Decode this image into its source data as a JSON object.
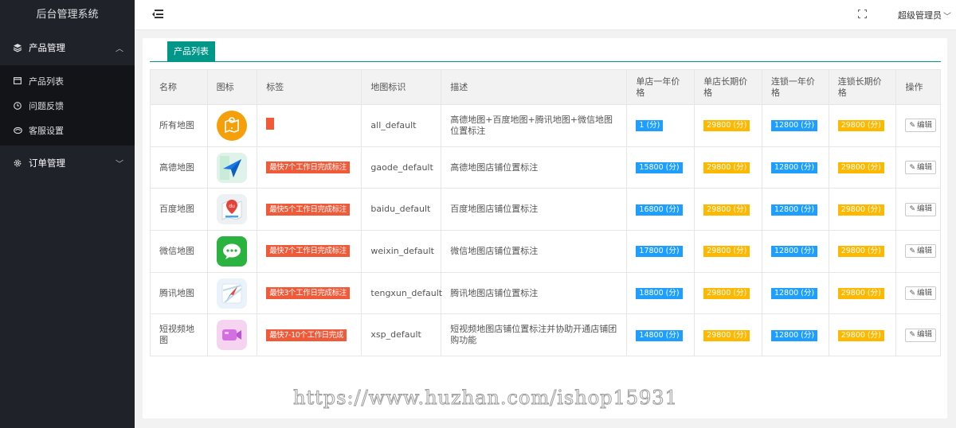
{
  "app": {
    "title": "后台管理系统"
  },
  "sidebar": {
    "groups": [
      {
        "label": "产品管理",
        "icon": "layers-icon",
        "expanded": true,
        "items": [
          {
            "label": "产品列表",
            "icon": "window-icon"
          },
          {
            "label": "问题反馈",
            "icon": "clock-icon"
          },
          {
            "label": "客服设置",
            "icon": "link-icon"
          }
        ]
      },
      {
        "label": "订单管理",
        "icon": "gear-icon",
        "expanded": false,
        "items": []
      }
    ]
  },
  "header": {
    "user_name": "超级管理员"
  },
  "tabs": [
    {
      "label": "产品列表",
      "active": true
    }
  ],
  "table": {
    "columns": [
      "名称",
      "图标",
      "标签",
      "地图标识",
      "描述",
      "单店一年价格",
      "单店长期价格",
      "连锁一年价格",
      "连锁长期价格",
      "操作"
    ],
    "rows": [
      {
        "name": "所有地图",
        "icon": "all-maps-icon",
        "tag": "",
        "key": "all_default",
        "desc": "高德地图+百度地图+腾讯地图+微信地图位置标注",
        "p1": "1 (分)",
        "p2": "29800 (分)",
        "p3": "12800 (分)",
        "p4": "29800 (分)",
        "action": "编辑"
      },
      {
        "name": "高德地图",
        "icon": "gaode-map-icon",
        "tag": "最快7个工作日完成标注",
        "key": "gaode_default",
        "desc": "高德地图店铺位置标注",
        "p1": "15800 (分)",
        "p2": "29800 (分)",
        "p3": "12800 (分)",
        "p4": "29800 (分)",
        "action": "编辑"
      },
      {
        "name": "百度地图",
        "icon": "baidu-map-icon",
        "tag": "最快5个工作日完成标注",
        "key": "baidu_default",
        "desc": "百度地图店铺位置标注",
        "p1": "16800 (分)",
        "p2": "29800 (分)",
        "p3": "12800 (分)",
        "p4": "29800 (分)",
        "action": "编辑"
      },
      {
        "name": "微信地图",
        "icon": "wechat-map-icon",
        "tag": "最快7个工作日完成标注",
        "key": "weixin_default",
        "desc": "微信地图店铺位置标注",
        "p1": "17800 (分)",
        "p2": "29800 (分)",
        "p3": "12800 (分)",
        "p4": "29800 (分)",
        "action": "编辑"
      },
      {
        "name": "腾讯地图",
        "icon": "tencent-map-icon",
        "tag": "最快3个工作日完成标注",
        "key": "tengxun_default",
        "desc": "腾讯地图店铺位置标注",
        "p1": "18800 (分)",
        "p2": "29800 (分)",
        "p3": "12800 (分)",
        "p4": "29800 (分)",
        "action": "编辑"
      },
      {
        "name": "短视频地图",
        "icon": "short-video-map-icon",
        "tag": "最快7-10个工作日完成",
        "key": "xsp_default",
        "desc": "短视频地图店铺位置标注并协助开通店铺团购功能",
        "p1": "14800 (分)",
        "p2": "29800 (分)",
        "p3": "12800 (分)",
        "p4": "29800 (分)",
        "action": "编辑"
      }
    ]
  },
  "watermark": "https://www.huzhan.com/ishop15931",
  "colors": {
    "sidebar": "#20222a",
    "accent": "#009688",
    "tag": "#f05a38",
    "badge_blue": "#1e9fff",
    "badge_orange": "#ffb800"
  }
}
